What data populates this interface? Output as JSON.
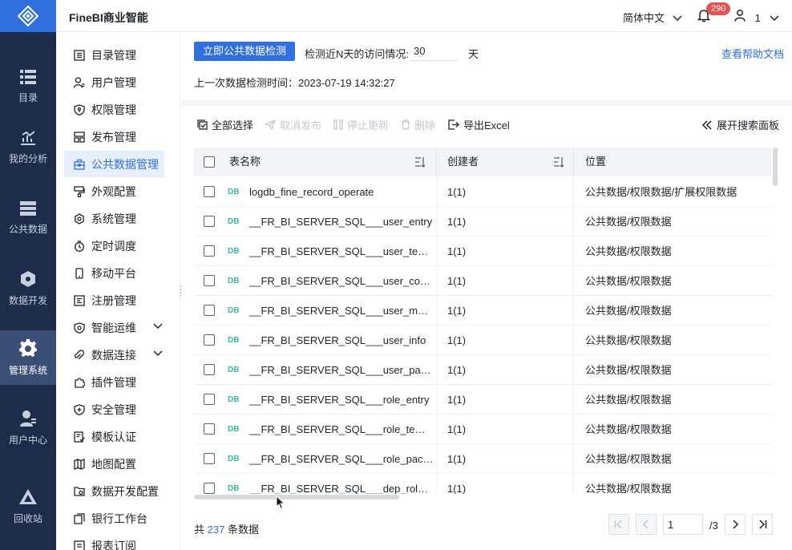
{
  "app": {
    "brand": "FineBI商业智能",
    "language": "简体中文",
    "notification_count": "290",
    "user_name": "1"
  },
  "rail": [
    {
      "label": "目录",
      "icon": "catalog-icon"
    },
    {
      "label": "我的分析",
      "icon": "analysis-icon"
    },
    {
      "label": "公共数据",
      "icon": "public-data-icon"
    },
    {
      "label": "数据开发",
      "icon": "data-dev-icon"
    },
    {
      "label": "管理系统",
      "icon": "gear-icon",
      "active": true
    },
    {
      "label": "用户中心",
      "icon": "user-center-icon"
    },
    {
      "label": "回收站",
      "icon": "recycle-bin-icon"
    }
  ],
  "sidebar": {
    "items": [
      {
        "label": "目录管理",
        "icon": "list-icon"
      },
      {
        "label": "用户管理",
        "icon": "user-icon"
      },
      {
        "label": "权限管理",
        "icon": "shield-icon"
      },
      {
        "label": "发布管理",
        "icon": "publish-icon"
      },
      {
        "label": "公共数据管理",
        "icon": "toolbox-icon",
        "active": true
      },
      {
        "label": "外观配置",
        "icon": "brush-icon"
      },
      {
        "label": "系统管理",
        "icon": "settings-icon"
      },
      {
        "label": "定时调度",
        "icon": "timer-icon"
      },
      {
        "label": "移动平台",
        "icon": "mobile-icon"
      },
      {
        "label": "注册管理",
        "icon": "register-icon"
      },
      {
        "label": "智能运维",
        "icon": "ops-icon",
        "expandable": true
      },
      {
        "label": "数据连接",
        "icon": "link-icon",
        "expandable": true
      },
      {
        "label": "插件管理",
        "icon": "plugin-icon"
      },
      {
        "label": "安全管理",
        "icon": "security-icon"
      },
      {
        "label": "模板认证",
        "icon": "template-icon"
      },
      {
        "label": "地图配置",
        "icon": "map-icon"
      },
      {
        "label": "数据开发配置",
        "icon": "dev-config-icon"
      },
      {
        "label": "银行工作台",
        "icon": "bank-icon"
      },
      {
        "label": "报表订阅",
        "icon": "subscribe-icon"
      }
    ]
  },
  "check": {
    "button_label": "立即公共数据检测",
    "days_label": "检测近N天的访问情况:",
    "days_value": "30",
    "days_unit": "天",
    "help_link": "查看帮助文档",
    "last_check": "上一次数据检测时间：2023-07-19 14:32:27"
  },
  "toolbar": {
    "select_all": "全部选择",
    "unpublish": "取消发布",
    "stop_update": "停止更新",
    "delete": "删除",
    "export": "导出Excel",
    "expand_search": "展开搜索面板"
  },
  "table": {
    "columns": [
      "表名称",
      "创建者",
      "位置"
    ],
    "db_tag": "DB",
    "rows": [
      {
        "name": "logdb_fine_record_operate",
        "creator": "1(1)",
        "location": "公共数据/权限数据/扩展权限数据"
      },
      {
        "name": "__FR_BI_SERVER_SQL___user_entry",
        "creator": "1(1)",
        "location": "公共数据/权限数据"
      },
      {
        "name": "__FR_BI_SERVER_SQL___user_template",
        "creator": "1(1)",
        "location": "公共数据/权限数据"
      },
      {
        "name": "__FR_BI_SERVER_SQL___user_connecti...",
        "creator": "1(1)",
        "location": "公共数据/权限数据"
      },
      {
        "name": "__FR_BI_SERVER_SQL___user_module",
        "creator": "1(1)",
        "location": "公共数据/权限数据"
      },
      {
        "name": "__FR_BI_SERVER_SQL___user_info",
        "creator": "1(1)",
        "location": "公共数据/权限数据"
      },
      {
        "name": "__FR_BI_SERVER_SQL___user_package",
        "creator": "1(1)",
        "location": "公共数据/权限数据"
      },
      {
        "name": "__FR_BI_SERVER_SQL___role_entry",
        "creator": "1(1)",
        "location": "公共数据/权限数据"
      },
      {
        "name": "__FR_BI_SERVER_SQL___role_template",
        "creator": "1(1)",
        "location": "公共数据/权限数据"
      },
      {
        "name": "__FR_BI_SERVER_SQL___role_package",
        "creator": "1(1)",
        "location": "公共数据/权限数据"
      },
      {
        "name": "__FR_BI_SERVER_SQL___dep_role_entry",
        "creator": "1(1)",
        "location": "公共数据/权限数据"
      }
    ]
  },
  "pagination": {
    "total_prefix": "共",
    "total_count": "237",
    "total_suffix": "条数据",
    "current_page": "1",
    "page_total": "/3"
  },
  "colors": {
    "primary": "#2f6fde",
    "rail_bg": "#1d2c48",
    "rail_active": "#3a4e76",
    "badge": "#e65251",
    "db_tag": "#3cb8a3"
  }
}
